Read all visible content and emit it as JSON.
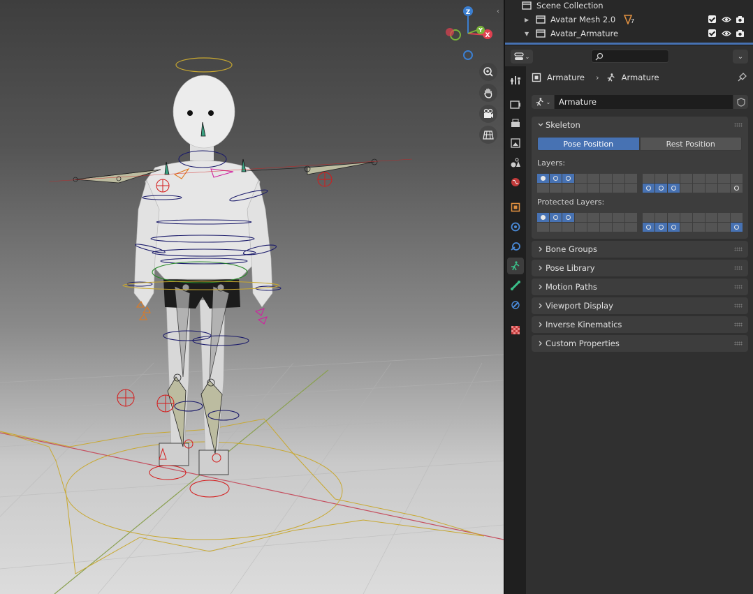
{
  "viewport": {
    "gizmo": {
      "z_label": "Z",
      "y_label": "Y",
      "x_label": "X"
    },
    "nav_icons": [
      "zoom-icon",
      "hand-pan-icon",
      "camera-icon",
      "grid-icon"
    ],
    "colors": {
      "x_axis": "#e04050",
      "y_axis": "#7ab33a",
      "z_axis": "#3b7fd1",
      "armature_outline": "#1a1a6a",
      "ik_target": "#d41b1b",
      "floor_control": "#c8a830"
    }
  },
  "outliner": {
    "rows": [
      {
        "label": "Scene Collection",
        "icon": "collection-icon"
      },
      {
        "label": "Avatar Mesh 2.0",
        "icon": "collection-icon",
        "badge": "7"
      },
      {
        "label": "Avatar_Armature",
        "icon": "collection-icon"
      }
    ],
    "selection_color": "#334d80"
  },
  "properties": {
    "breadcrumb": {
      "object": "Armature",
      "data": "Armature"
    },
    "datablock_name": "Armature",
    "skeleton": {
      "title": "Skeleton",
      "pose_position": "Pose Position",
      "rest_position": "Rest Position",
      "active_mode": "Pose Position",
      "layers_label": "Layers:",
      "protected_layers_label": "Protected Layers:"
    },
    "panels": [
      "Bone Groups",
      "Pose Library",
      "Motion Paths",
      "Viewport Display",
      "Inverse Kinematics",
      "Custom Properties"
    ],
    "tabs": [
      "tool-icon",
      "render-icon",
      "output-icon",
      "view-layer-icon",
      "scene-icon",
      "world-icon",
      "object-icon",
      "modifiers-icon",
      "particles-icon",
      "physics-icon",
      "armature-data-icon",
      "bone-icon",
      "bone-constraints-icon",
      "texture-icon"
    ],
    "accent": "#4772b3"
  }
}
